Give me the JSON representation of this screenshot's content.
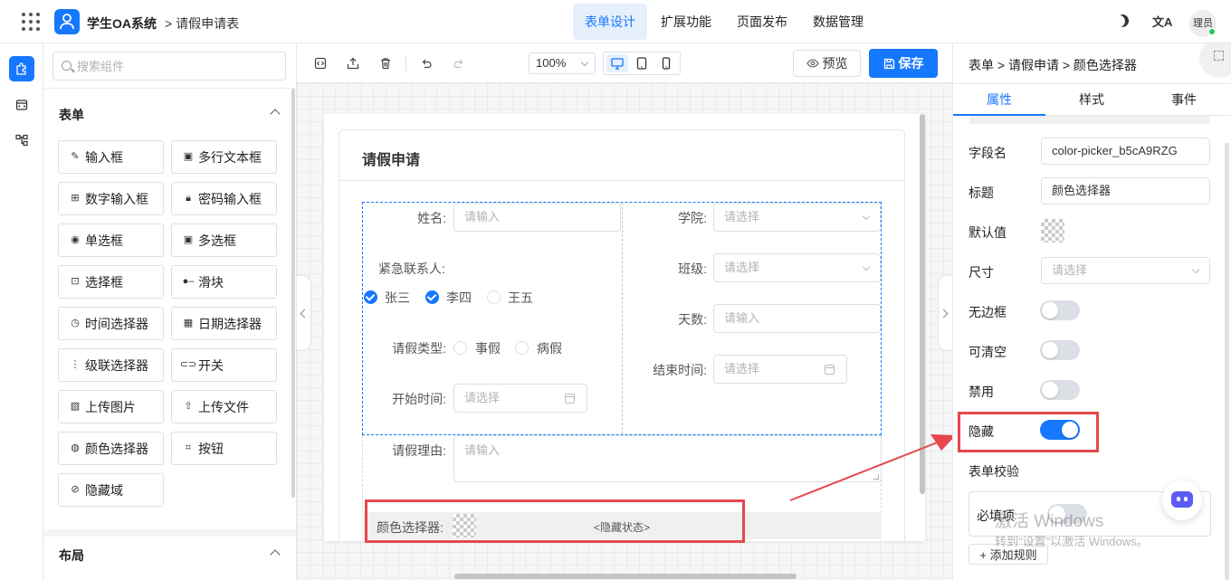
{
  "header": {
    "app_title": "学生OA系统",
    "breadcrumb": "> 请假申请表",
    "nav": [
      "表单设计",
      "扩展功能",
      "页面发布",
      "数据管理"
    ],
    "nav_active_index": 0,
    "translate_glyph": "文A",
    "user_label": "理员"
  },
  "components": {
    "search_placeholder": "搜索组件",
    "group_form": "表单",
    "items": [
      "输入框",
      "多行文本框",
      "数字输入框",
      "密码输入框",
      "单选框",
      "多选框",
      "选择框",
      "滑块",
      "时间选择器",
      "日期选择器",
      "级联选择器",
      "开关",
      "上传图片",
      "上传文件",
      "颜色选择器",
      "按钮",
      "隐藏域"
    ],
    "group_layout": "布局"
  },
  "toolbar": {
    "zoom": "100%",
    "preview_label": "预览",
    "save_label": "保存",
    "active_device": "desktop"
  },
  "form": {
    "title": "请假申请",
    "name_label": "姓名:",
    "name_placeholder": "请输入",
    "college_label": "学院:",
    "college_placeholder": "请选择",
    "contact_label": "紧急联系人:",
    "contacts": [
      {
        "label": "张三",
        "checked": true
      },
      {
        "label": "李四",
        "checked": true
      },
      {
        "label": "王五",
        "checked": false
      }
    ],
    "class_label": "班级:",
    "class_placeholder": "请选择",
    "days_label": "天数:",
    "days_placeholder": "请输入",
    "type_label": "请假类型:",
    "types": [
      "事假",
      "病假"
    ],
    "end_label": "结束时间:",
    "end_placeholder": "请选择",
    "start_label": "开始时间:",
    "start_placeholder": "请选择",
    "reason_label": "请假理由:",
    "reason_placeholder": "请输入",
    "color_label": "颜色选择器:",
    "hidden_state": "<隐藏状态>"
  },
  "props": {
    "breadcrumb": "表单 > 请假申请 > 颜色选择器",
    "tabs": [
      "属性",
      "样式",
      "事件"
    ],
    "active_tab": 0,
    "field_name_label": "字段名",
    "field_name_value": "color-picker_b5cA9RZG",
    "title_label": "标题",
    "title_value": "颜色选择器",
    "default_label": "默认值",
    "size_label": "尺寸",
    "size_placeholder": "请选择",
    "no_border_label": "无边框",
    "no_border": false,
    "clearable_label": "可清空",
    "clearable": false,
    "disabled_label": "禁用",
    "disabled": false,
    "hidden_label": "隐藏",
    "hidden": true,
    "validation_label": "表单校验",
    "required_label": "必填项",
    "required": false,
    "add_rule_label": "+ 添加规则"
  },
  "watermark": {
    "line1": "激活 Windows",
    "line2": "转到\"设置\"以激活 Windows。"
  },
  "colors": {
    "primary": "#1677ff",
    "highlight": "#e5484d",
    "online": "#22c55e"
  }
}
